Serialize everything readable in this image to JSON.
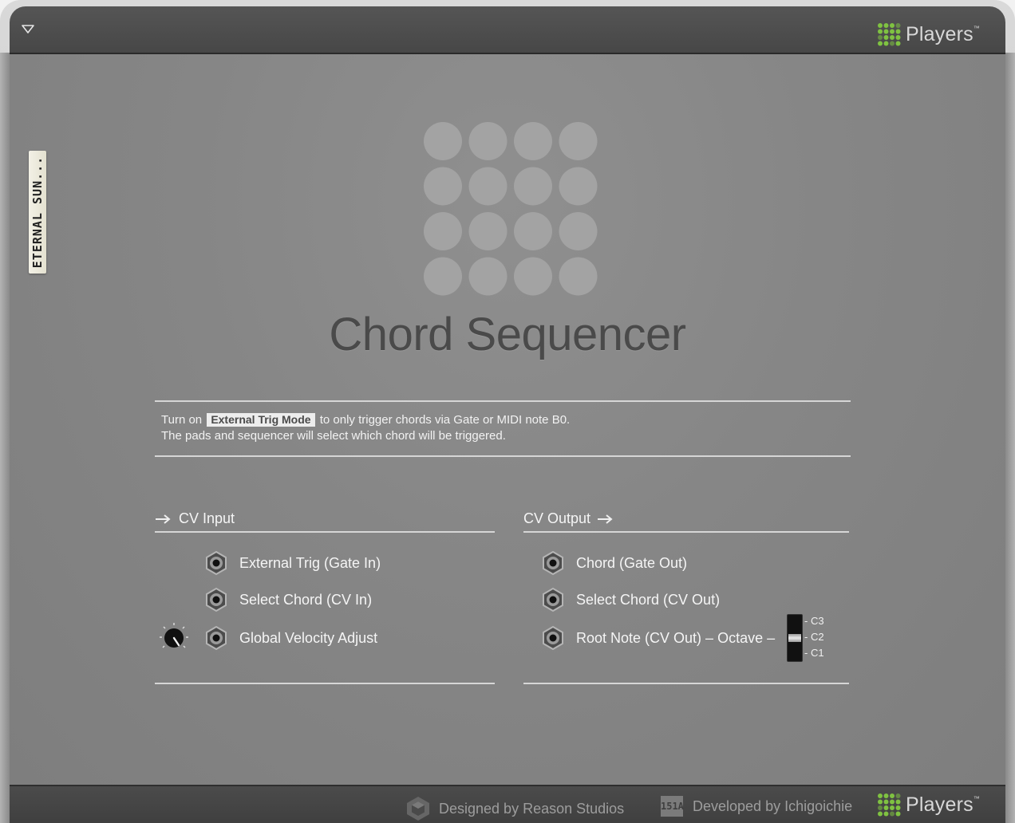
{
  "header": {
    "brand": "Players",
    "brand_mark": "™"
  },
  "tape_label": "ETERNAL SUN...",
  "device": {
    "title": "Chord Sequencer"
  },
  "info": {
    "line1_before": "Turn on ",
    "line1_chip": "External Trig Mode",
    "line1_after": " to only trigger chords via Gate or MIDI note B0.",
    "line2": "The pads and sequencer will select which chord will be triggered."
  },
  "cv_input": {
    "label": "CV Input",
    "rows": [
      {
        "label": "External Trig (Gate In)"
      },
      {
        "label": "Select Chord (CV In)"
      },
      {
        "label": "Global Velocity Adjust"
      }
    ]
  },
  "cv_output": {
    "label": "CV Output",
    "rows": [
      {
        "label": "Chord (Gate Out)"
      },
      {
        "label": "Select Chord (CV Out)"
      },
      {
        "label": "Root Note (CV Out) – Octave –"
      }
    ],
    "octave_options": [
      "- C3",
      "- C2",
      "- C1"
    ],
    "octave_selected": "- C2"
  },
  "footer": {
    "designed_by": "Designed by Reason Studios",
    "badge": "151A",
    "developed_by": "Developed by Ichigoichie",
    "brand": "Players",
    "brand_mark": "™"
  },
  "colors": {
    "panel": "#868686",
    "brand_green": "#7fc241",
    "text_light": "#f5f5f5",
    "title": "#4a4a4a"
  }
}
